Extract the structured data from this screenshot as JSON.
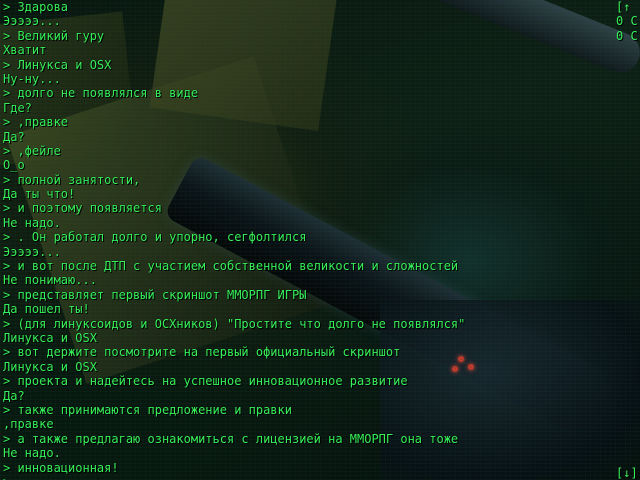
{
  "theme": {
    "text_color": "#37f05a",
    "background_color": "#020806"
  },
  "console": {
    "lines": [
      "> Здарова",
      "Эээээ...",
      "> Великий гуру",
      "Хватит",
      "> Линукса и OSX",
      "Ну-ну...",
      "> долго не появлялся в виде",
      "Где?",
      "> ,правке",
      "Да?",
      "> ,фейле",
      "О_о",
      "> полной занятости,",
      "Да ты что!",
      "> и поэтому появляется",
      "Не надо.",
      "> . Он работал долго и упорно, сегфолтился",
      "Эээээ...",
      "> и вот после ДТП с участием собственной великости и сложностей",
      "Не понимаю...",
      "> представляет первый скриншот ММОРПГ ИГРЫ",
      "Да пошел ты!",
      "> (для линуксоидов и ОСХников) \"Простите что долго не появлялся\"",
      "Линукса и OSX",
      "> вот держите посмотрите на первый официальный скриншот",
      "Линукса и OSX",
      "> проекта и надейтесь на успешное инновационное развитие",
      "Да?",
      "> также принимаются предложение и правки",
      ",правке",
      "> а также предлагаю ознакомиться с лицензией на ММОРПГ она тоже",
      "Не надо.",
      "> инновационная!",
      ">"
    ]
  },
  "hud": {
    "top_right": [
      "[↑",
      "0 C",
      "0 C"
    ],
    "bottom_right": "[↓]"
  }
}
